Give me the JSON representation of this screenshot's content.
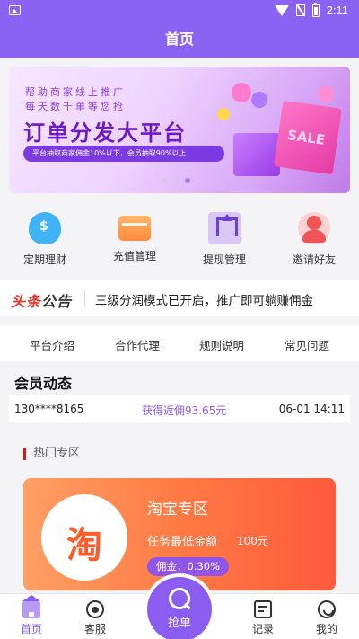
{
  "status_bar": {
    "time": "2:11"
  },
  "header": {
    "title": "首页"
  },
  "banner": {
    "line1": "帮助商家线上推广",
    "line2": "每天数千单等您抢",
    "headline": "订单分发大平台",
    "pill": "平台抽取商家佣金10%以下，会员抽取90%以上",
    "bag_text": "SALE"
  },
  "menu": [
    {
      "label": "定期理财",
      "icon": "piggy-bank-icon"
    },
    {
      "label": "充值管理",
      "icon": "card-icon"
    },
    {
      "label": "提现管理",
      "icon": "withdraw-icon"
    },
    {
      "label": "邀请好友",
      "icon": "friends-icon"
    }
  ],
  "notice": {
    "brand_a": "头条",
    "brand_b": "公告",
    "text": "三级分润模式已开启，推广即可躺赚佣金"
  },
  "links": [
    "平台介绍",
    "合作代理",
    "规则说明",
    "常见问题"
  ],
  "member_dynamics": {
    "title": "会员动态",
    "rows": [
      {
        "user": "130****8165",
        "action": "获得返佣93.65元",
        "time": "06-01 14:11"
      }
    ]
  },
  "hot_zone": {
    "title": "热门专区",
    "card": {
      "logo_char": "淘",
      "name": "淘宝专区",
      "min_label": "任务最低金额",
      "min_amount": "100元",
      "commission": "佣金：0.30%"
    }
  },
  "tabbar": {
    "home": "首页",
    "service": "客服",
    "grab": "抢单",
    "records": "记录",
    "mine": "我的"
  },
  "colors": {
    "primary": "#8a63f3",
    "accent_orange": "#ff7a45",
    "notice_red": "#e2342b"
  }
}
